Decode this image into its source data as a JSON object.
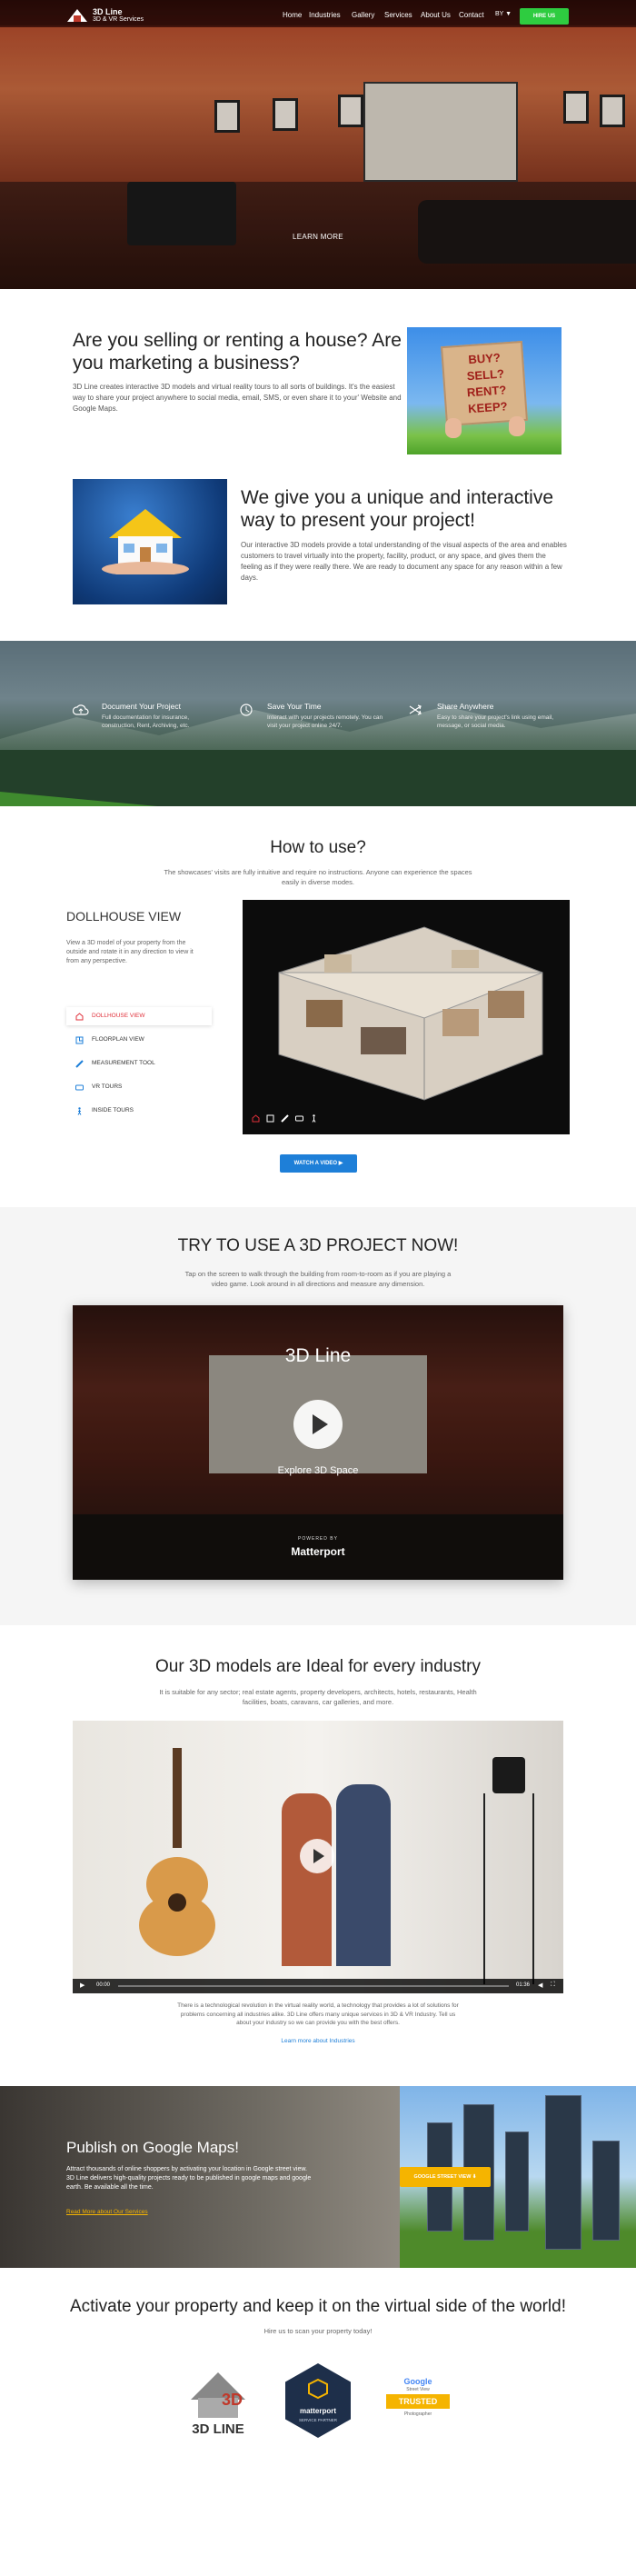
{
  "brand": {
    "name": "3D Line",
    "tagline": "3D & VR Services"
  },
  "nav": {
    "items": [
      "Home",
      "Industries",
      "Gallery",
      "Services",
      "About Us",
      "Contact"
    ],
    "language": "BY ▼",
    "hire_button": "HIRE US"
  },
  "hero": {
    "learn_more": "LEARN MORE"
  },
  "intro": {
    "title": "Are you selling or renting a house? Are you marketing a business?",
    "text": "3D Line creates interactive 3D models and virtual reality tours to all sorts of buildings. It's the easiest way to share your project anywhere to social media, email, SMS, or even share it to your' Website and Google Maps.",
    "sign_lines": [
      "BUY?",
      "SELL?",
      "RENT?",
      "KEEP?"
    ]
  },
  "unique": {
    "title": "We give you a unique and interactive way to present your project!",
    "text": "Our interactive 3D models provide a total understanding of the visual aspects of the area and enables customers to travel virtually into the property, facility, product, or any space, and gives them the feeling as if they were really there. We are ready to document any space for any reason within a few days."
  },
  "features": [
    {
      "title": "Document Your Project",
      "text": "Full documentation for insurance, construction, Rent, Archiving, etc.",
      "icon": "cloud-upload-icon"
    },
    {
      "title": "Save Your Time",
      "text": "Interact with your projects remotely. You can visit your project online 24/7.",
      "icon": "clock-icon"
    },
    {
      "title": "Share Anywhere",
      "text": "Easy to share your project's link using email, message, or social media.",
      "icon": "share-icon"
    }
  ],
  "how": {
    "title": "How to use?",
    "subtitle": "The showcases' visits are fully intuitive and require no instructions. Anyone can experience the spaces easily in diverse modes.",
    "mode_title": "DOLLHOUSE VIEW",
    "mode_text": "View a 3D model of your property from the outside and rotate it in any direction to view it from any perspective.",
    "menu": [
      "DOLLHOUSE VIEW",
      "FLOORPLAN VIEW",
      "MEASUREMENT TOOL",
      "VR TOURS",
      "INSIDE TOURS"
    ],
    "watch_button": "WATCH A VIDEO"
  },
  "try": {
    "title": "TRY TO USE A 3D PROJECT NOW!",
    "subtitle": "Tap on the screen to walk through the building from room-to-room as if you are playing a video game. Look around in all directions and measure any dimension.",
    "tour_title": "3D Line",
    "explore": "Explore 3D Space",
    "powered": "POWERED BY",
    "matterport": "Matterport"
  },
  "industry": {
    "title": "Our 3D models are Ideal for every industry",
    "subtitle": "It is suitable for any sector; real estate agents, property developers, architects, hotels, restaurants, Health facilities, boats, caravans, car galleries, and more.",
    "time_current": "00:00",
    "time_duration": "01:36",
    "text": "There is a technological revolution in the virtual reality world, a technology that provides a lot of solutions for problems concerning all industries alike. 3D Line offers many unique services in 3D & VR Industry. Tell us about your industry so we can provide you with the best offers.",
    "link": "Learn more about Industries"
  },
  "maps": {
    "title": "Publish on Google Maps!",
    "text": "Attract thousands of online shoppers by activating your location in Google street view. 3D Line delivers high-quality projects ready to be published in google maps and google earth. Be available all the time.",
    "link": "Read More about Our Services",
    "button": "GOOGLE STREET VIEW ⬇"
  },
  "cta": {
    "title": "Activate your property and keep it on the virtual side of the world!",
    "subtitle": "Hire us to scan your property today!",
    "logo_text": "3D LINE",
    "mp_name": "matterport",
    "mp_sub": "SERVICE PARTNER",
    "g_name": "Google",
    "g_sv": "Street View",
    "g_trusted": "TRUSTED",
    "g_photo": "Photographer"
  },
  "colors": {
    "accent": "#2ecc40",
    "blue": "#1e7fd8",
    "red": "#e0303a",
    "gold": "#f5b400"
  }
}
